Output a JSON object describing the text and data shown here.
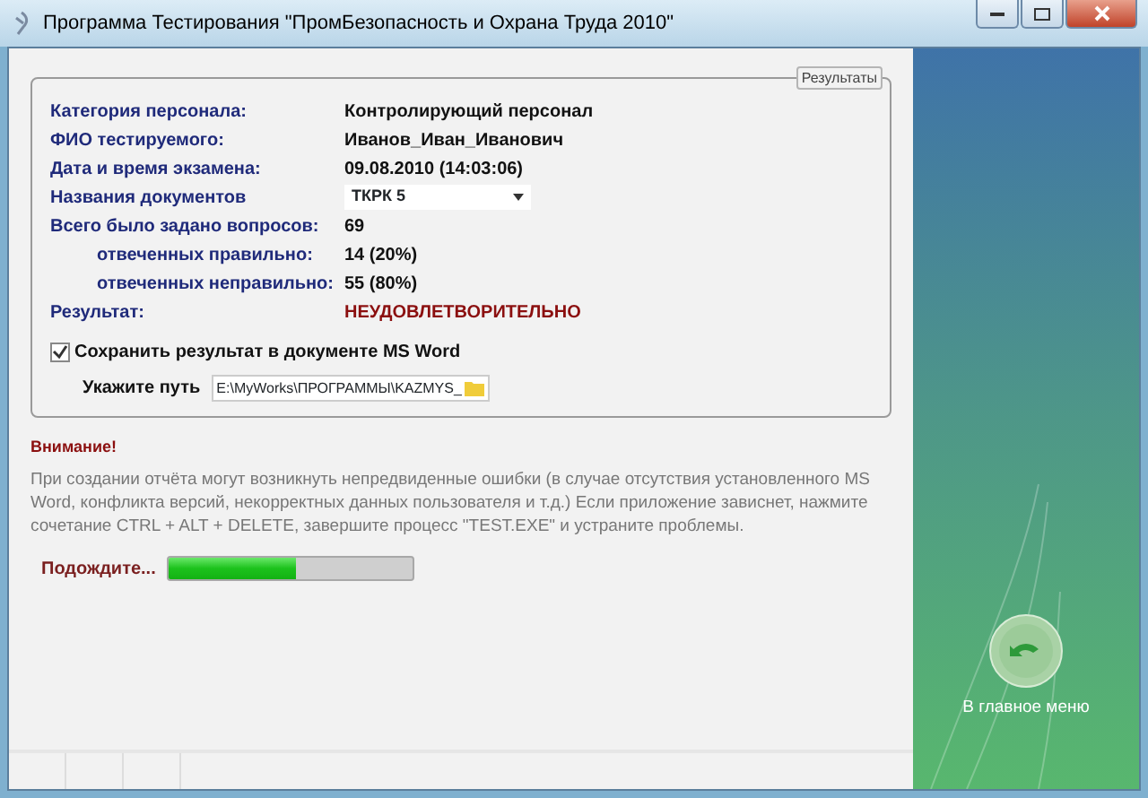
{
  "window": {
    "title": "Программа Тестирования \"ПромБезопасность и Охрана Труда 2010\""
  },
  "results_group": {
    "title": "Результаты",
    "rows": [
      {
        "kind": "text",
        "label": "Категория персонала:",
        "value": "Контролирующий персонал"
      },
      {
        "kind": "text",
        "label": "ФИО тестируемого:",
        "value": "Иванов_Иван_Иванович"
      },
      {
        "kind": "text",
        "label": "Дата и время экзамена:",
        "value": "09.08.2010  (14:03:06)"
      },
      {
        "kind": "dropdown",
        "label": "Названия документов",
        "value": "ТКРК 5"
      },
      {
        "kind": "text",
        "label": "Всего было задано вопросов:",
        "value": "69",
        "children": [
          {
            "kind": "text",
            "label": "отвеченных правильно:",
            "value": "14 (20%)"
          },
          {
            "kind": "text",
            "label": "отвеченных неправильно:",
            "value": "55 (80%)"
          }
        ]
      },
      {
        "kind": "result",
        "label": "Результат:",
        "value": "НЕУДОВЛЕТВОРИТЕЛЬНО"
      }
    ],
    "save_checkbox": {
      "label": "Сохранить результат в документе MS Word",
      "checked": true
    },
    "path": {
      "label": "Укажите путь",
      "value": "E:\\MyWorks\\ПРОГРАММЫ\\KAZMYS_"
    }
  },
  "warning": {
    "title": "Внимание!",
    "text": "При создании отчёта могут возникнуть непредвиденные ошибки (в случае отсутствия установленного MS Word, конфликта версий, некорректных данных пользователя и т.д.)  Если приложение зависнет, нажмите сочетание CTRL  + ALT + DELETE, завершите процесс \"TEST.EXE\" и устраните проблемы."
  },
  "progress": {
    "label": "Подождите...",
    "level": 0.52
  },
  "side_panel": {
    "main_menu_button": "В главное меню"
  }
}
